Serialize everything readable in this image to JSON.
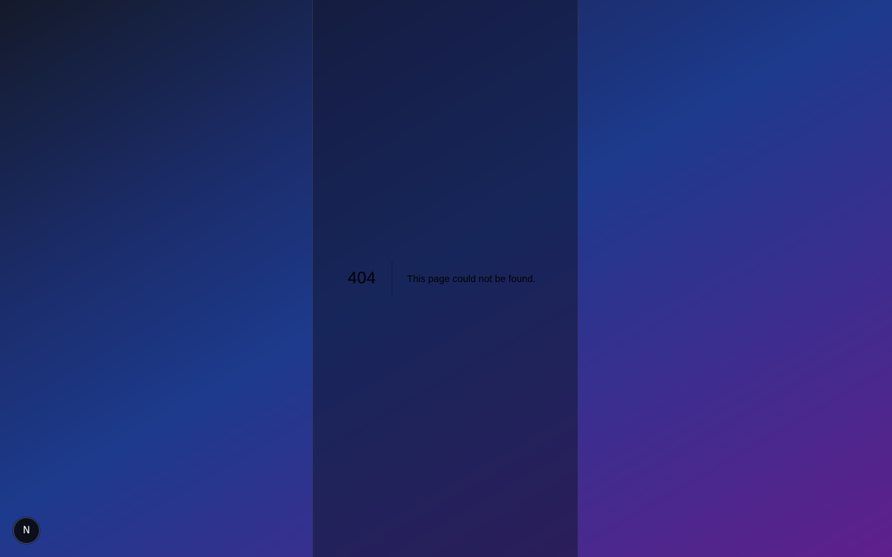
{
  "error": {
    "code": "404",
    "message": "This page could not be found."
  },
  "dev_badge": {
    "label": "N",
    "icon": "nextjs-logo-icon"
  },
  "colors": {
    "bg_top_left": "#141a2a",
    "bg_mid": "#1d3a8c",
    "bg_bottom_right": "#5f1f8c",
    "panel": "#121632",
    "text": "#000000"
  }
}
